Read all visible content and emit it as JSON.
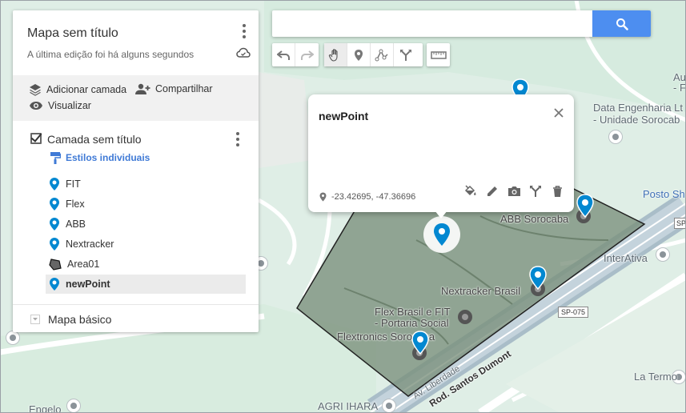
{
  "panel": {
    "map_title": "Mapa sem título",
    "last_edit": "A última edição foi há alguns segundos",
    "actions": {
      "add_layer": "Adicionar camada",
      "share": "Compartilhar",
      "preview": "Visualizar"
    },
    "layer": {
      "title": "Camada sem título",
      "styles_link": "Estilos individuais",
      "items": [
        {
          "label": "FIT",
          "icon": "blue-pin-icon"
        },
        {
          "label": "Flex",
          "icon": "blue-pin-icon"
        },
        {
          "label": "ABB",
          "icon": "blue-pin-icon"
        },
        {
          "label": "Nextracker",
          "icon": "blue-pin-icon"
        },
        {
          "label": "Area01",
          "icon": "polygon-icon"
        },
        {
          "label": "newPoint",
          "icon": "blue-pin-icon"
        }
      ]
    },
    "basemap": "Mapa básico"
  },
  "search": {
    "value": "",
    "placeholder": ""
  },
  "toolbar": [
    "undo-icon",
    "redo-icon",
    "hand-icon",
    "marker-icon",
    "line-icon",
    "directions-icon",
    "ruler-icon"
  ],
  "popup": {
    "title": "newPoint",
    "coords": "-23.42695, -47.36696"
  },
  "map": {
    "labels": {
      "data_eng_1": "Data Engenharia Lt",
      "data_eng_2": "- Unidade Sorocab",
      "abb": "ABB Sorocaba",
      "posto": "Posto Sh",
      "interativa": "InterAtiva",
      "nextracker": "Nextracker Brasil",
      "flex_1": "Flex Brasil e FIT",
      "flex_2": "- Portaria Social",
      "flextronics": "Flextronics Sorocaba",
      "sp075": "SP-075",
      "sp_small": "SP",
      "av_liberdade": "Av. Liberdade",
      "rod_santos": "Rod. Santos Dumont",
      "agri": "AGRI IHARA",
      "engelo": "Engelo",
      "termo": "La Termo",
      "au_1": "Au",
      "au_2": "- F"
    }
  },
  "colors": {
    "accent": "#4d8ef0",
    "pin": "#0288d1",
    "polygon_fill": "#7a8f7b",
    "map_bg": "#dfeee6"
  }
}
